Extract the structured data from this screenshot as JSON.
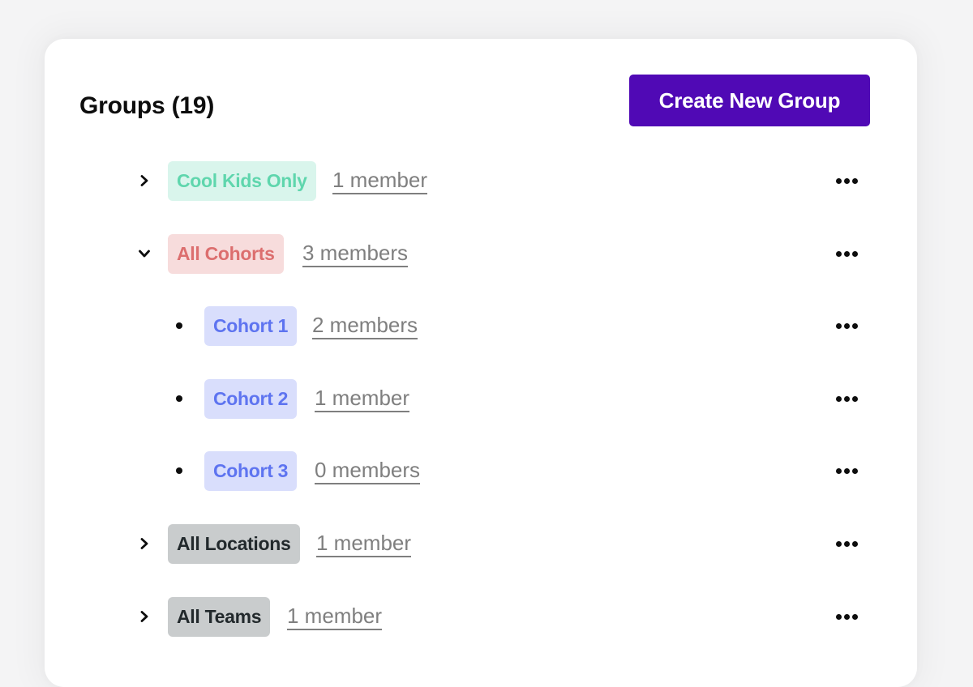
{
  "header": {
    "title": "Groups (19)",
    "create_button_label": "Create New Group"
  },
  "colors": {
    "primary": "#5009b5",
    "badge_green_bg": "#d9f5ec",
    "badge_green_text": "#5fd6ad",
    "badge_red_bg": "#f7dcdc",
    "badge_red_text": "#dc6e6e",
    "badge_blue_bg": "#d9defc",
    "badge_blue_text": "#5e74f0",
    "badge_gray_bg": "#c9cccd",
    "badge_gray_text": "#22292c",
    "member_link": "#7f7f7f"
  },
  "groups": [
    {
      "name": "Cool Kids Only",
      "members": "1 member",
      "level": "top",
      "state": "collapsed",
      "color": "green",
      "more_icon": "ellipsis-icon"
    },
    {
      "name": "All Cohorts",
      "members": "3 members",
      "level": "top",
      "state": "expanded",
      "color": "red",
      "more_icon": "ellipsis-icon"
    },
    {
      "name": "Cohort 1",
      "members": "2 members",
      "level": "child",
      "state": "leaf",
      "color": "blue",
      "more_icon": "ellipsis-icon"
    },
    {
      "name": "Cohort 2",
      "members": "1 member",
      "level": "child",
      "state": "leaf",
      "color": "blue",
      "more_icon": "ellipsis-icon"
    },
    {
      "name": "Cohort 3",
      "members": "0 members",
      "level": "child",
      "state": "leaf",
      "color": "blue",
      "more_icon": "ellipsis-icon"
    },
    {
      "name": "All Locations",
      "members": "1 member",
      "level": "top",
      "state": "collapsed",
      "color": "gray",
      "more_icon": "ellipsis-icon"
    },
    {
      "name": "All Teams",
      "members": "1 member",
      "level": "top",
      "state": "collapsed",
      "color": "gray",
      "more_icon": "ellipsis-icon"
    }
  ]
}
